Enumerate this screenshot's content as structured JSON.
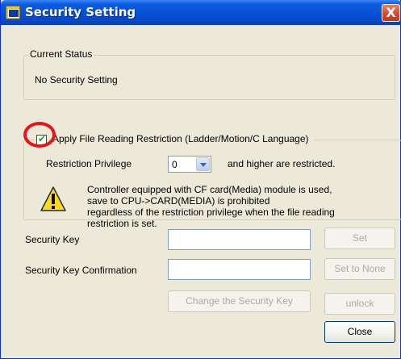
{
  "window": {
    "title": "Security Setting",
    "close_glyph": "X"
  },
  "current_status": {
    "legend": "Current Status",
    "value": "No Security Setting"
  },
  "restriction": {
    "checkbox_checked": true,
    "checkbox_label": "Apply File Reading Restriction (Ladder/Motion/C Language)",
    "privilege_label": "Restriction Privilege",
    "privilege_value": "0",
    "suffix": "and higher are restricted.",
    "warning_lines": [
      "Controller equipped with CF card(Media) module is used,",
      "save to CPU->CARD(MEDIA) is prohibited",
      "regardless of the restriction privilege when the file reading",
      "restriction is set."
    ]
  },
  "security_key": {
    "label": "Security Key",
    "value": "",
    "set_button": "Set"
  },
  "security_key_confirm": {
    "label": "Security Key Confirmation",
    "value": "",
    "set_none_button": "Set to None"
  },
  "buttons": {
    "change_key": "Change the Security Key",
    "unlock": "unlock",
    "close": "Close"
  },
  "icons": {
    "app": "app-icon",
    "warning": "warning-icon",
    "close": "close-icon"
  },
  "colors": {
    "titlebar": "#0550d4",
    "dialog_bg": "#ece9d8",
    "annotation": "#e8141a"
  }
}
